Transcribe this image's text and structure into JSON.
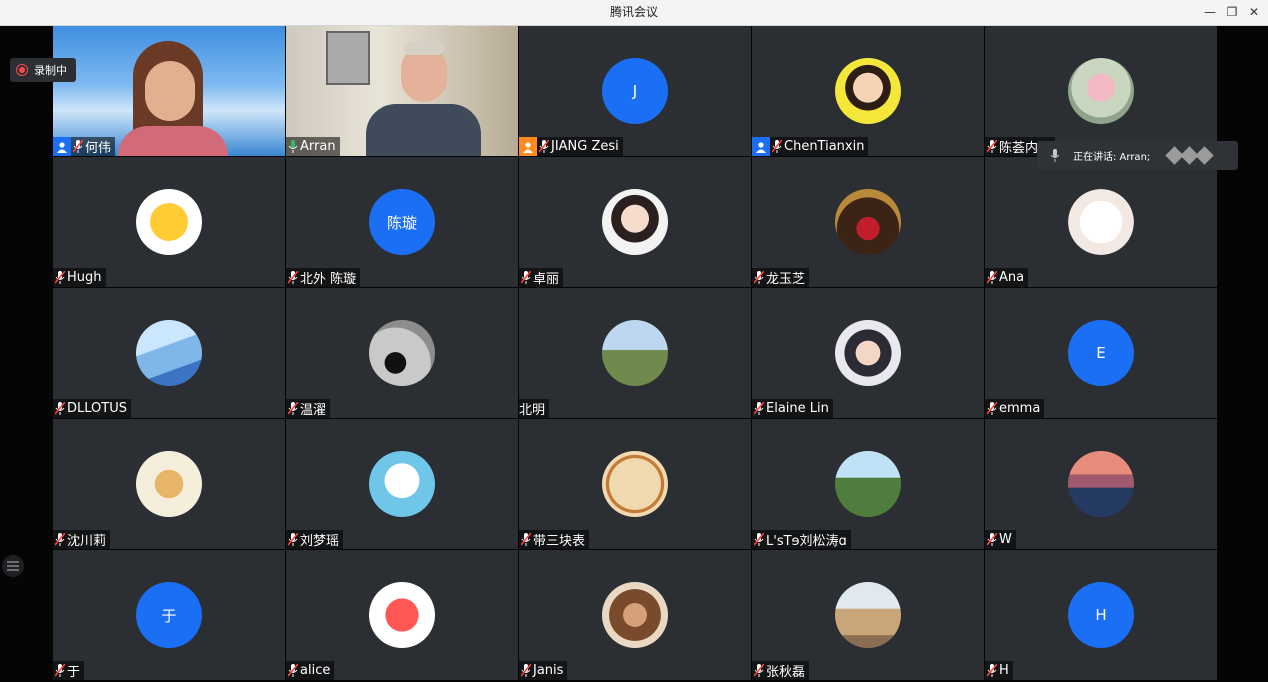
{
  "window": {
    "title": "腾讯会议"
  },
  "recording": {
    "label": "录制中"
  },
  "speaking": {
    "label": "正在讲话: Arran;"
  },
  "colors": {
    "accent": "#1b6ff5",
    "speaking": "#2fbf5b",
    "recording": "#ff4a4a",
    "tile": "#2b2e32"
  },
  "participants": [
    {
      "name": "何伟",
      "avatar": "video-woman",
      "role": "host"
    },
    {
      "name": "Arran",
      "avatar": "video-man",
      "active": true
    },
    {
      "name": "JIANG Zesi",
      "avatar": "initial",
      "initial": "J",
      "role": "cohost"
    },
    {
      "name": "ChenTianxin",
      "avatar": "photo-girl",
      "role": "host"
    },
    {
      "name": "陈荟内…",
      "avatar": "photo-lotus"
    },
    {
      "name": "Hugh",
      "avatar": "photo-sun"
    },
    {
      "name": "北外 陈璇",
      "avatar": "initial",
      "initial": "陈璇"
    },
    {
      "name": "卓丽",
      "avatar": "photo-portrait"
    },
    {
      "name": "龙玉芝",
      "avatar": "photo-dress"
    },
    {
      "name": "Ana",
      "avatar": "photo-cat"
    },
    {
      "name": "DLLOTUS",
      "avatar": "photo-rainbow"
    },
    {
      "name": "温濯",
      "avatar": "photo-silhouette"
    },
    {
      "name": "北明",
      "avatar": "photo-landscape"
    },
    {
      "name": "Elaine Lin",
      "avatar": "photo-cap"
    },
    {
      "name": "emma",
      "avatar": "initial",
      "initial": "E"
    },
    {
      "name": "沈川莉",
      "avatar": "photo-illustration"
    },
    {
      "name": "刘梦瑶",
      "avatar": "photo-rabbit"
    },
    {
      "name": "带三块表",
      "avatar": "photo-seal"
    },
    {
      "name": "L'sTɘ刘松涛ɑ",
      "avatar": "photo-park"
    },
    {
      "name": "W",
      "avatar": "photo-mountain"
    },
    {
      "name": "于",
      "avatar": "initial",
      "initial": "于"
    },
    {
      "name": "alice",
      "avatar": "photo-pig"
    },
    {
      "name": "Janis",
      "avatar": "photo-cafe"
    },
    {
      "name": "张秋磊",
      "avatar": "photo-bridge"
    },
    {
      "name": "H",
      "avatar": "initial",
      "initial": "H"
    }
  ]
}
